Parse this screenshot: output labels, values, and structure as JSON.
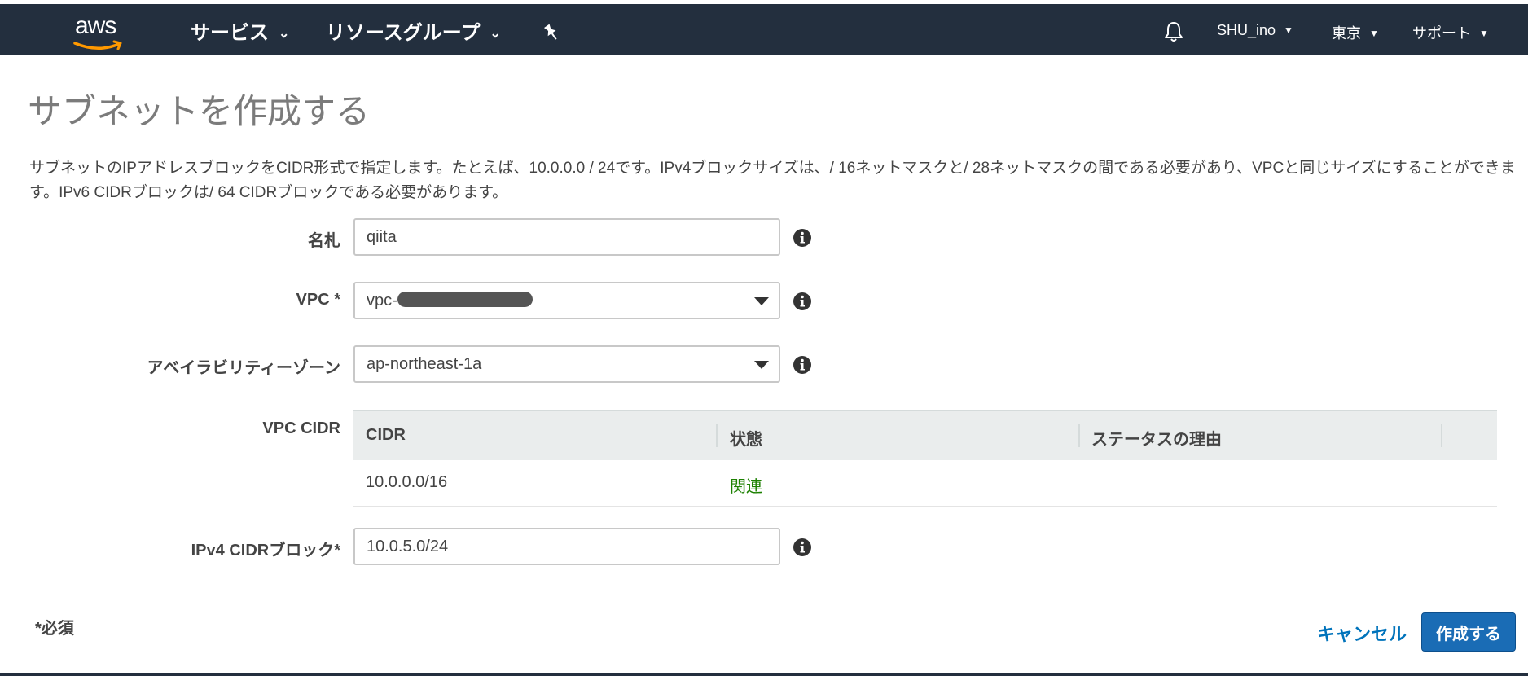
{
  "nav": {
    "logo": "aws",
    "services": "サービス",
    "resource_groups": "リソースグループ",
    "user": "SHU_ino",
    "region": "東京",
    "support": "サポート"
  },
  "page": {
    "title": "サブネットを作成する",
    "description": "サブネットのIPアドレスブロックをCIDR形式で指定します。たとえば、10.0.0.0 / 24です。IPv4ブロックサイズは、/ 16ネットマスクと/ 28ネットマスクの間である必要があり、VPCと同じサイズにすることができます。IPv6 CIDRブロックは/ 64 CIDRブロックである必要があります。"
  },
  "form": {
    "name_label": "名札",
    "name_value": "qiita",
    "vpc_label": "VPC *",
    "vpc_value": "vpc-",
    "az_label": "アベイラビリティーゾーン",
    "az_value": "ap-northeast-1a",
    "vpc_cidr_label": "VPC CIDR",
    "ipv4_label": "IPv4 CIDRブロック*",
    "ipv4_value": "10.0.5.0/24"
  },
  "cidr_table": {
    "headers": [
      "CIDR",
      "状態",
      "ステータスの理由"
    ],
    "rows": [
      {
        "cidr": "10.0.0.0/16",
        "status": "関連",
        "reason": ""
      }
    ]
  },
  "footer": {
    "required_note": "*必須",
    "cancel_label": "キャンセル",
    "create_label": "作成する"
  },
  "colors": {
    "nav_bg": "#232f3e",
    "primary_button": "#1a6cb5",
    "link": "#0073bb",
    "status_ok": "#1d8102"
  }
}
